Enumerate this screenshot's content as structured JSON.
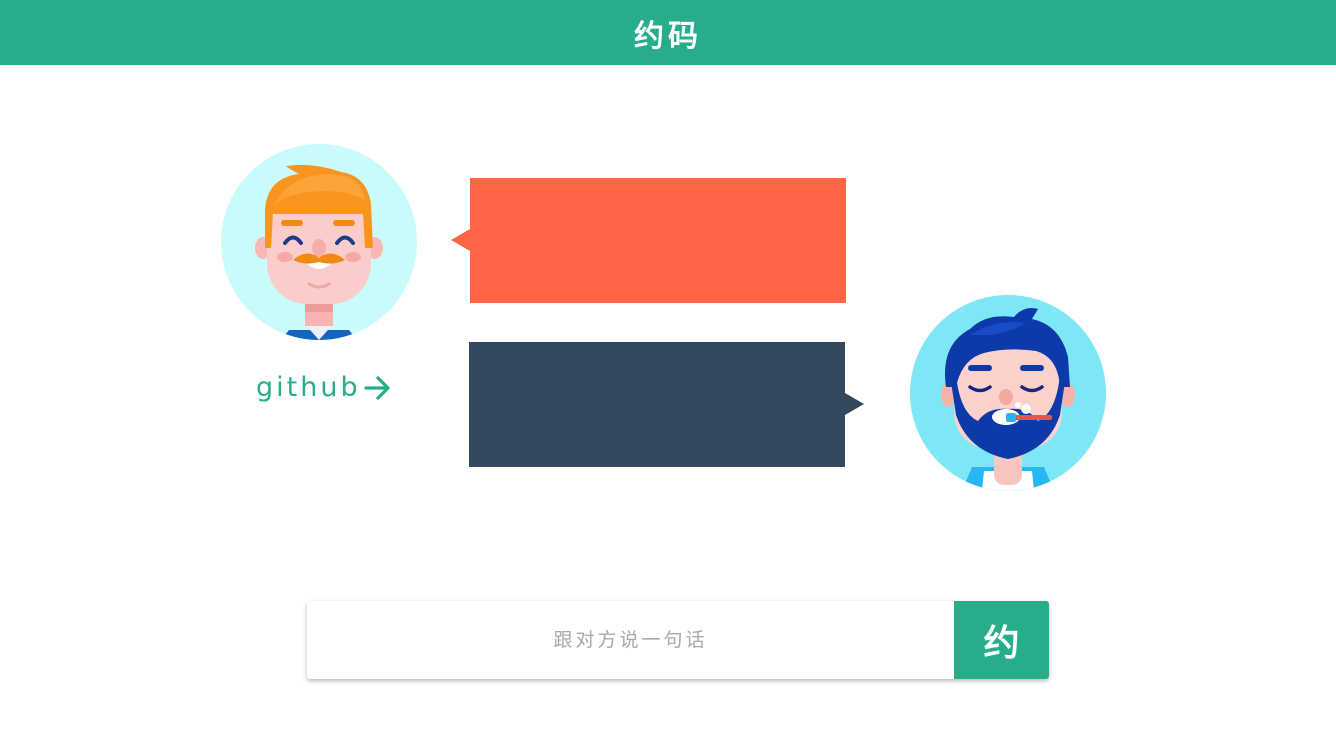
{
  "header": {
    "title": "约码"
  },
  "github_link": {
    "label": "github",
    "icon": "arrow-right-icon"
  },
  "chat": {
    "left_message": {
      "text": "",
      "color": "#ff6443"
    },
    "right_message": {
      "text": "",
      "color": "#34495e"
    }
  },
  "avatars": {
    "left": {
      "icon": "orange-haired-man-avatar",
      "bg": "#c8fbfa"
    },
    "right": {
      "icon": "blue-bearded-man-avatar",
      "bg": "#7ee7f5"
    }
  },
  "composer": {
    "placeholder": "跟对方说一句话",
    "value": "",
    "send_label": "约"
  },
  "colors": {
    "accent": "#27ad8b",
    "white": "#ffffff"
  }
}
